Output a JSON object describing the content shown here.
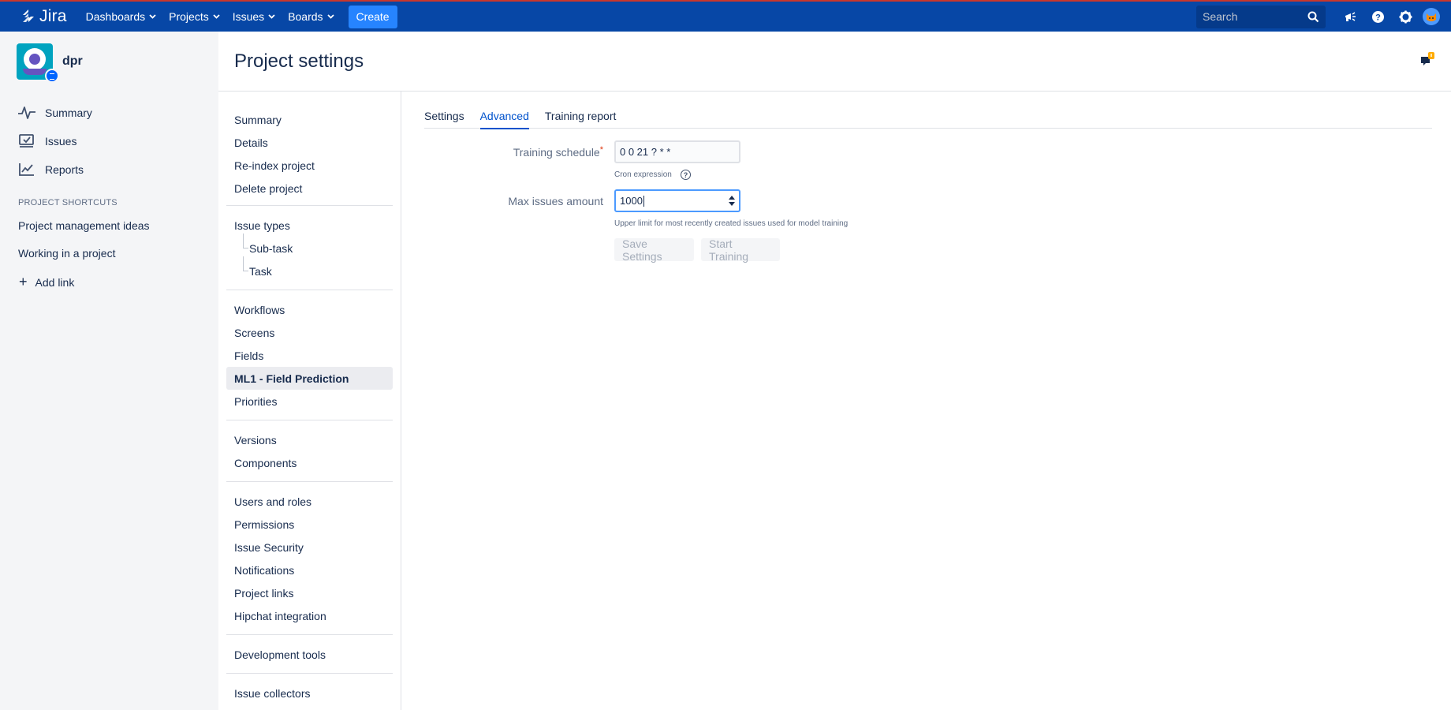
{
  "topnav": {
    "logo_text": "Jira",
    "menus": [
      {
        "label": "Dashboards"
      },
      {
        "label": "Projects"
      },
      {
        "label": "Issues"
      },
      {
        "label": "Boards"
      }
    ],
    "create_label": "Create",
    "search_placeholder": "Search",
    "icons": [
      "megaphone-icon",
      "help-icon",
      "settings-icon",
      "user-avatar"
    ],
    "colors": {
      "bar": "#0747a6",
      "create": "#2684ff"
    }
  },
  "sidebar": {
    "project_name": "dpr",
    "nav": [
      {
        "label": "Summary",
        "icon": "activity-icon"
      },
      {
        "label": "Issues",
        "icon": "issues-icon"
      },
      {
        "label": "Reports",
        "icon": "reports-icon"
      }
    ],
    "shortcuts_title": "PROJECT SHORTCUTS",
    "shortcuts": [
      "Project management ideas",
      "Working in a project"
    ],
    "add_link_label": "Add link"
  },
  "main": {
    "page_title": "Project settings",
    "settings_nav": {
      "groups": [
        [
          "Summary",
          "Details",
          "Re-index project",
          "Delete project"
        ],
        [
          "Issue types",
          "Sub-task",
          "Task"
        ],
        [
          "Workflows",
          "Screens",
          "Fields",
          "ML1 - Field Prediction",
          "Priorities"
        ],
        [
          "Versions",
          "Components"
        ],
        [
          "Users and roles",
          "Permissions",
          "Issue Security",
          "Notifications",
          "Project links",
          "Hipchat integration"
        ],
        [
          "Development tools"
        ],
        [
          "Issue collectors"
        ]
      ],
      "selected": "ML1 - Field Prediction"
    },
    "tabs": [
      {
        "label": "Settings"
      },
      {
        "label": "Advanced"
      },
      {
        "label": "Training report"
      }
    ],
    "active_tab": "Advanced",
    "form": {
      "training_schedule_label": "Training schedule",
      "required_mark": "*",
      "training_schedule_value": "0 0 21 ? * *",
      "cron_help": "Cron expression",
      "help_glyph": "?",
      "max_issues_label": "Max issues amount",
      "max_issues_value": "1000",
      "max_issues_help": "Upper limit for most recently created issues used for model training",
      "save_label": "Save Settings",
      "start_label": "Start Training"
    }
  }
}
